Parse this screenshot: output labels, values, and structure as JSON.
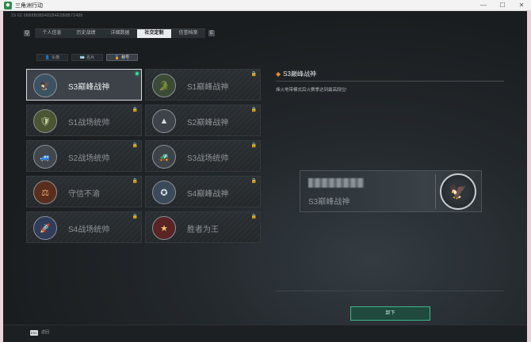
{
  "window": {
    "title": "三角洲行动",
    "app_icon": "app-logo-icon",
    "controls": {
      "minimize": "—",
      "maximize": "☐",
      "close": "✕"
    }
  },
  "user_id": "29 62 08B8B0B8481B4E5B8B72488",
  "main_tabs": {
    "prev_key": "Q",
    "next_key": "E",
    "items": [
      {
        "label": "个人信息",
        "active": false
      },
      {
        "label": "历史战绩",
        "active": false
      },
      {
        "label": "详细数据",
        "active": false
      },
      {
        "label": "社交定制",
        "active": true
      },
      {
        "label": "信誉档案",
        "active": false
      }
    ]
  },
  "sub_tabs": [
    {
      "label": "头像",
      "icon": "person-icon",
      "glyph": "👤",
      "active": false
    },
    {
      "label": "名片",
      "icon": "card-icon",
      "glyph": "🪪",
      "active": false
    },
    {
      "label": "称号",
      "icon": "badge-icon",
      "glyph": "🏅",
      "active": true
    }
  ],
  "badges": [
    {
      "name": "S3巅峰战神",
      "icon": "eagle-globe-medal-icon",
      "glyph": "🦅",
      "color": "#e8edf1",
      "bg": "#3b5262",
      "locked": false,
      "selected": true
    },
    {
      "name": "S1巅峰战神",
      "icon": "crocodile-medal-icon",
      "glyph": "🐊",
      "color": "#cfe3c4",
      "bg": "#3c4b36",
      "locked": true,
      "selected": false
    },
    {
      "name": "S1战场统帅",
      "icon": "tank-medal-icon",
      "glyph": "🛡",
      "color": "#cdd6a8",
      "bg": "#4a5531",
      "locked": true,
      "selected": false
    },
    {
      "name": "S2巅峰战神",
      "icon": "triangle-emblem-icon",
      "glyph": "▲",
      "color": "#d7dbde",
      "bg": "#3d4348",
      "locked": true,
      "selected": false
    },
    {
      "name": "S2战场统帅",
      "icon": "armored-vehicle-medal-icon",
      "glyph": "🚙",
      "color": "#d3d7db",
      "bg": "#41474c",
      "locked": true,
      "selected": false
    },
    {
      "name": "S3战场统帅",
      "icon": "tank-silver-medal-icon",
      "glyph": "🚜",
      "color": "#d7dadd",
      "bg": "#3d4348",
      "locked": true,
      "selected": false
    },
    {
      "name": "守信不渝",
      "icon": "scales-medal-icon",
      "glyph": "⚖",
      "color": "#f0b07a",
      "bg": "#5a2e1c",
      "locked": true,
      "selected": false
    },
    {
      "name": "S4巅峰战神",
      "icon": "elite-squad-medal-icon",
      "glyph": "✪",
      "color": "#dfe4e8",
      "bg": "#3a4a5a",
      "locked": true,
      "selected": false
    },
    {
      "name": "S4战场统帅",
      "icon": "missile-medal-icon",
      "glyph": "🚀",
      "color": "#cfd8e6",
      "bg": "#2f3d5a",
      "locked": true,
      "selected": false
    },
    {
      "name": "胜者为王",
      "icon": "star-medal-icon",
      "glyph": "★",
      "color": "#f2c56b",
      "bg": "#5a2424",
      "locked": true,
      "selected": false
    }
  ],
  "lock_glyph": "🔒",
  "detail": {
    "icon": "diamond-icon",
    "icon_glyph": "◆",
    "title": "S3巅峰战神",
    "description": "烽火地带模式后火赛季达到最高段位!",
    "preview_name": "S3巅峰战神",
    "preview_icon": "eagle-globe-medal-icon",
    "preview_glyph": "🦅"
  },
  "equip_button": "卸下",
  "footer": {
    "esc_key": "ESC",
    "back_label": "返回"
  },
  "colors": {
    "accent_green": "#3ad59a",
    "equip_border": "#3fb58a",
    "detail_diamond": "#e08a3a"
  }
}
